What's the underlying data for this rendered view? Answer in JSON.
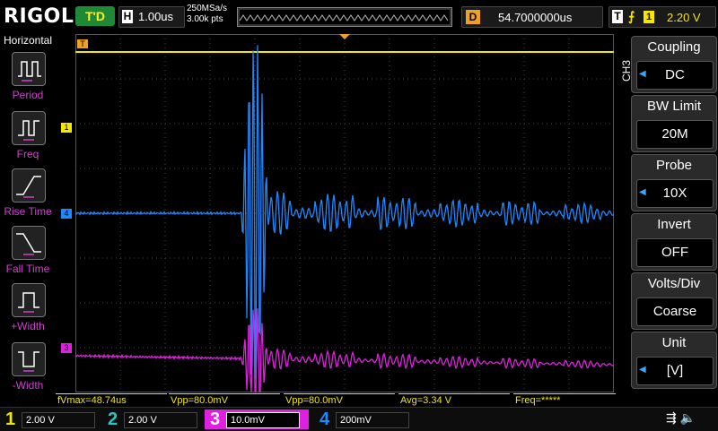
{
  "brand": "RIGOL",
  "status": {
    "trigger_state": "T'D"
  },
  "horizontal": {
    "label": "H",
    "timebase": "1.00us",
    "sample_rate": "250MSa/s",
    "points": "3.00k pts"
  },
  "delay": {
    "label": "D",
    "value": "54.7000000us"
  },
  "trigger": {
    "label": "T",
    "edge_icon": "rising-edge",
    "source": "1",
    "level": "2.20 V"
  },
  "left_menu": {
    "title": "Horizontal",
    "items": [
      {
        "label": "Period",
        "icon": "period-icon"
      },
      {
        "label": "Freq",
        "icon": "frequency-icon"
      },
      {
        "label": "Rise Time",
        "icon": "rise-time-icon"
      },
      {
        "label": "Fall Time",
        "icon": "fall-time-icon"
      },
      {
        "label": "+Width",
        "icon": "positive-width-icon"
      },
      {
        "label": "-Width",
        "icon": "negative-width-icon"
      }
    ]
  },
  "right_menu": {
    "channel": "CH3",
    "items": [
      {
        "title": "Coupling",
        "value": "DC"
      },
      {
        "title": "BW Limit",
        "value": "20M"
      },
      {
        "title": "Probe",
        "value": "10X"
      },
      {
        "title": "Invert",
        "value": "OFF"
      },
      {
        "title": "Volts/Div",
        "value": "Coarse"
      },
      {
        "title": "Unit",
        "value": "[V]"
      }
    ]
  },
  "markers": {
    "trigger_pos": "T",
    "ch1": "1",
    "ch4": "4",
    "ch3": "3"
  },
  "measurements": [
    {
      "text": "fVmax=48.74us"
    },
    {
      "text": "Vpp=80.0mV"
    },
    {
      "text": "Vpp=80.0mV"
    },
    {
      "text": "Avg=3.34 V"
    },
    {
      "text": "Freq=*****"
    }
  ],
  "channels": [
    {
      "num": "1",
      "scale": "2.00 V",
      "color": "#f5e700"
    },
    {
      "num": "2",
      "scale": "2.00 V",
      "color": "#22c8c8"
    },
    {
      "num": "3",
      "scale": "10.0mV",
      "color": "#e020e0"
    },
    {
      "num": "4",
      "scale": "200mV",
      "color": "#1e88ff"
    }
  ],
  "colors": {
    "ch1": "#f5e700",
    "ch3": "#e020e0",
    "ch4": "#1e88ff",
    "grid": "#444444"
  }
}
